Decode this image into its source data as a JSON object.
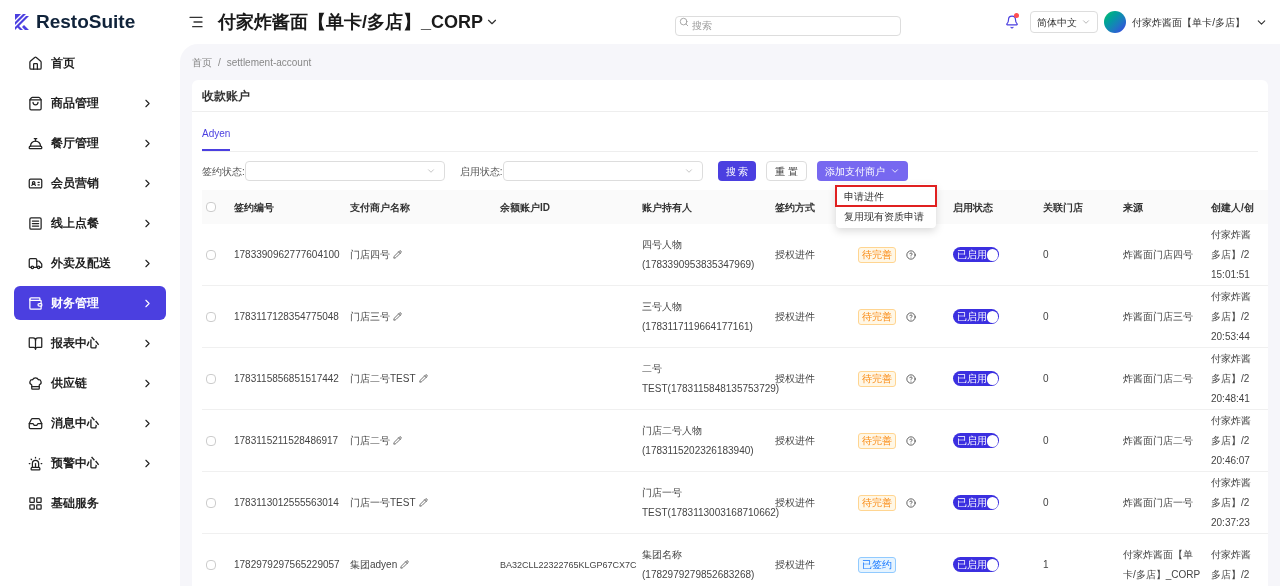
{
  "brand": {
    "name": "RestoSuite"
  },
  "header": {
    "title": "付家炸酱面【单卡/多店】_CORP",
    "search_placeholder": "搜索",
    "notification": {
      "unread": true
    },
    "language": "简体中文",
    "user": "付家炸酱面【单卡/多店】"
  },
  "sidebar": {
    "items": [
      {
        "label": "首页",
        "has_children": false,
        "selected": false
      },
      {
        "label": "商品管理",
        "has_children": true,
        "selected": false
      },
      {
        "label": "餐厅管理",
        "has_children": true,
        "selected": false
      },
      {
        "label": "会员营销",
        "has_children": true,
        "selected": false
      },
      {
        "label": "线上点餐",
        "has_children": true,
        "selected": false
      },
      {
        "label": "外卖及配送",
        "has_children": true,
        "selected": false
      },
      {
        "label": "财务管理",
        "has_children": true,
        "selected": true
      },
      {
        "label": "报表中心",
        "has_children": true,
        "selected": false
      },
      {
        "label": "供应链",
        "has_children": true,
        "selected": false
      },
      {
        "label": "消息中心",
        "has_children": true,
        "selected": false
      },
      {
        "label": "预警中心",
        "has_children": true,
        "selected": false
      },
      {
        "label": "基础服务",
        "has_children": false,
        "selected": false
      }
    ]
  },
  "breadcrumb": {
    "items": [
      "首页",
      "settlement-account"
    ],
    "separator": "/"
  },
  "page_title": "收款账户",
  "tabs": [
    {
      "label": "Adyen",
      "selected": true
    }
  ],
  "filters": [
    {
      "label": "签约状态:"
    },
    {
      "label": "启用状态:"
    }
  ],
  "buttons": {
    "search": "搜 索",
    "reset": "重 置",
    "add": "添加支付商户"
  },
  "add_menu": [
    {
      "label": "申请进件",
      "highlighted": true
    },
    {
      "label": "复用现有资质申请",
      "highlighted": false
    }
  ],
  "table": {
    "select_all_checked": false,
    "columns": [
      {
        "label": "签约编号"
      },
      {
        "label": "支付商户名称"
      },
      {
        "label": "余额账户ID"
      },
      {
        "label": "账户持有人"
      },
      {
        "label": "签约方式"
      },
      {},
      {
        "label": "启用状态"
      },
      {
        "label": "关联门店"
      },
      {
        "label": "来源"
      },
      {
        "label": "创建人/创"
      }
    ],
    "rows": [
      {
        "checked": false,
        "id": "1783390962777604100",
        "merchant": "门店四号",
        "balance_id": "",
        "holder": [
          "四号人物",
          "(1783390953835347969)"
        ],
        "method": "授权进件",
        "status": {
          "label": "待完善",
          "kind": "pending"
        },
        "help_icon": true,
        "enabled": {
          "label": "已启用",
          "on": true
        },
        "stores": "0",
        "source": [
          "炸酱面门店四号"
        ],
        "creator": [
          "付家炸酱",
          "多店】/2",
          "15:01:51"
        ]
      },
      {
        "checked": false,
        "id": "1783117128354775048",
        "merchant": "门店三号",
        "balance_id": "",
        "holder": [
          "三号人物",
          "(1783117119664177161)"
        ],
        "method": "授权进件",
        "status": {
          "label": "待完善",
          "kind": "pending"
        },
        "help_icon": true,
        "enabled": {
          "label": "已启用",
          "on": true
        },
        "stores": "0",
        "source": [
          "炸酱面门店三号"
        ],
        "creator": [
          "付家炸酱",
          "多店】/2",
          "20:53:44"
        ]
      },
      {
        "checked": false,
        "id": "1783115856851517442",
        "merchant": "门店二号TEST",
        "balance_id": "",
        "holder": [
          "二号",
          "TEST(1783115848135753729)"
        ],
        "method": "授权进件",
        "status": {
          "label": "待完善",
          "kind": "pending"
        },
        "help_icon": true,
        "enabled": {
          "label": "已启用",
          "on": true
        },
        "stores": "0",
        "source": [
          "炸酱面门店二号"
        ],
        "creator": [
          "付家炸酱",
          "多店】/2",
          "20:48:41"
        ]
      },
      {
        "checked": false,
        "id": "1783115211528486917",
        "merchant": "门店二号",
        "balance_id": "",
        "holder": [
          "门店二号人物",
          "(1783115202326183940)"
        ],
        "method": "授权进件",
        "status": {
          "label": "待完善",
          "kind": "pending"
        },
        "help_icon": true,
        "enabled": {
          "label": "已启用",
          "on": true
        },
        "stores": "0",
        "source": [
          "炸酱面门店二号"
        ],
        "creator": [
          "付家炸酱",
          "多店】/2",
          "20:46:07"
        ]
      },
      {
        "checked": false,
        "id": "1783113012555563014",
        "merchant": "门店一号TEST",
        "balance_id": "",
        "holder": [
          "门店一号",
          "TEST(1783113003168710662)"
        ],
        "method": "授权进件",
        "status": {
          "label": "待完善",
          "kind": "pending"
        },
        "help_icon": true,
        "enabled": {
          "label": "已启用",
          "on": true
        },
        "stores": "0",
        "source": [
          "炸酱面门店一号"
        ],
        "creator": [
          "付家炸酱",
          "多店】/2",
          "20:37:23"
        ]
      },
      {
        "checked": false,
        "id": "1782979297565229057",
        "merchant": "集团adyen",
        "balance_id": "BA32CLL22322765KLGP67CX7C",
        "holder": [
          "集团名称",
          "(1782979279852683268)"
        ],
        "method": "授权进件",
        "status": {
          "label": "已签约",
          "kind": "signed"
        },
        "help_icon": false,
        "enabled": {
          "label": "已启用",
          "on": true
        },
        "stores": "1",
        "source": [
          "付家炸酱面【单",
          "卡/多店】_CORP"
        ],
        "creator": [
          "付家炸酱",
          "多店】/2"
        ]
      }
    ]
  }
}
